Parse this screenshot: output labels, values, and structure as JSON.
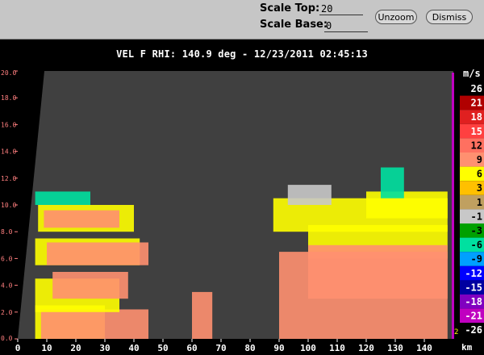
{
  "toolbar": {
    "scale_top_label": "Scale Top:",
    "scale_top_value": "20",
    "scale_base_label": "Scale Base:",
    "scale_base_value": "0",
    "unzoom_label": "Unzoom",
    "dismiss_label": "Dismiss"
  },
  "plot": {
    "title": "VEL F  RHI: 140.9 deg  -  12/23/2011 02:45:13",
    "x_unit": "km",
    "legend_unit": "m/s",
    "legend_marker": "2"
  },
  "colors": {
    "background": "#000000",
    "plot_area": "#404040",
    "toolbar": "#c6c6c6",
    "tick_color": "#ff7f7f"
  },
  "chart_data": {
    "type": "heatmap",
    "title": "VEL F  RHI: 140.9 deg  -  12/23/2011 02:45:13",
    "xlabel": "km",
    "ylabel": "",
    "xlim": [
      0,
      150
    ],
    "ylim": [
      0,
      20
    ],
    "x_ticks": [
      "0",
      "10",
      "20",
      "30",
      "40",
      "50",
      "60",
      "70",
      "80",
      "90",
      "100",
      "110",
      "120",
      "130",
      "140"
    ],
    "y_ticks": [
      "0.0",
      "2.0",
      "4.0",
      "6.0",
      "8.0",
      "10.0",
      "12.0",
      "14.0",
      "16.0",
      "18.0",
      "20.0"
    ],
    "colorbar": {
      "unit": "m/s",
      "levels": [
        {
          "label": "26",
          "color": "#000000",
          "text": "#ffffff"
        },
        {
          "label": "21",
          "color": "#b00000",
          "text": "#ffffff"
        },
        {
          "label": "18",
          "color": "#e02020",
          "text": "#ffffff"
        },
        {
          "label": "15",
          "color": "#ff4040",
          "text": "#ffffff"
        },
        {
          "label": "12",
          "color": "#ff7060",
          "text": "#000000"
        },
        {
          "label": "9",
          "color": "#ff9070",
          "text": "#000000"
        },
        {
          "label": "6",
          "color": "#ffff00",
          "text": "#000000"
        },
        {
          "label": "3",
          "color": "#ffc000",
          "text": "#000000"
        },
        {
          "label": "1",
          "color": "#c0a060",
          "text": "#000000"
        },
        {
          "label": "-1",
          "color": "#c8c8c8",
          "text": "#000000"
        },
        {
          "label": "-3",
          "color": "#00a000",
          "text": "#000000"
        },
        {
          "label": "-6",
          "color": "#00e0a0",
          "text": "#000000"
        },
        {
          "label": "-9",
          "color": "#00a0ff",
          "text": "#000000"
        },
        {
          "label": "-12",
          "color": "#0000ff",
          "text": "#ffffff"
        },
        {
          "label": "-15",
          "color": "#0000a0",
          "text": "#ffffff"
        },
        {
          "label": "-18",
          "color": "#8000c0",
          "text": "#ffffff"
        },
        {
          "label": "-21",
          "color": "#c000c0",
          "text": "#ffffff"
        },
        {
          "label": "-26",
          "color": "#000000",
          "text": "#ffffff"
        }
      ]
    },
    "echo_regions": [
      {
        "x": [
          6,
          30
        ],
        "y": [
          0,
          2.5
        ],
        "color": "#ffff00"
      },
      {
        "x": [
          8,
          45
        ],
        "y": [
          0,
          2.2
        ],
        "color": "#ff9070"
      },
      {
        "x": [
          6,
          35
        ],
        "y": [
          2,
          4.5
        ],
        "color": "#ffff00"
      },
      {
        "x": [
          12,
          38
        ],
        "y": [
          3,
          5
        ],
        "color": "#ff9070"
      },
      {
        "x": [
          6,
          42
        ],
        "y": [
          5.5,
          7.5
        ],
        "color": "#ffff00"
      },
      {
        "x": [
          10,
          45
        ],
        "y": [
          5.5,
          7.2
        ],
        "color": "#ff9070"
      },
      {
        "x": [
          7,
          40
        ],
        "y": [
          8,
          10
        ],
        "color": "#ffff00"
      },
      {
        "x": [
          9,
          35
        ],
        "y": [
          8.3,
          9.6
        ],
        "color": "#ff9070"
      },
      {
        "x": [
          6,
          25
        ],
        "y": [
          10,
          11
        ],
        "color": "#00e0a0"
      },
      {
        "x": [
          60,
          67
        ],
        "y": [
          0,
          3.5
        ],
        "color": "#ff9070"
      },
      {
        "x": [
          88,
          148
        ],
        "y": [
          8,
          10.5
        ],
        "color": "#ffff00"
      },
      {
        "x": [
          100,
          148
        ],
        "y": [
          6,
          8.5
        ],
        "color": "#ffff00"
      },
      {
        "x": [
          120,
          148
        ],
        "y": [
          9,
          11
        ],
        "color": "#ffff00"
      },
      {
        "x": [
          90,
          148
        ],
        "y": [
          0,
          6.5
        ],
        "color": "#ff9070"
      },
      {
        "x": [
          100,
          148
        ],
        "y": [
          3,
          7
        ],
        "color": "#ff9070"
      },
      {
        "x": [
          125,
          133
        ],
        "y": [
          10.5,
          12.8
        ],
        "color": "#00e0a0"
      },
      {
        "x": [
          93,
          108
        ],
        "y": [
          10,
          11.5
        ],
        "color": "#c8c8c8"
      }
    ]
  }
}
